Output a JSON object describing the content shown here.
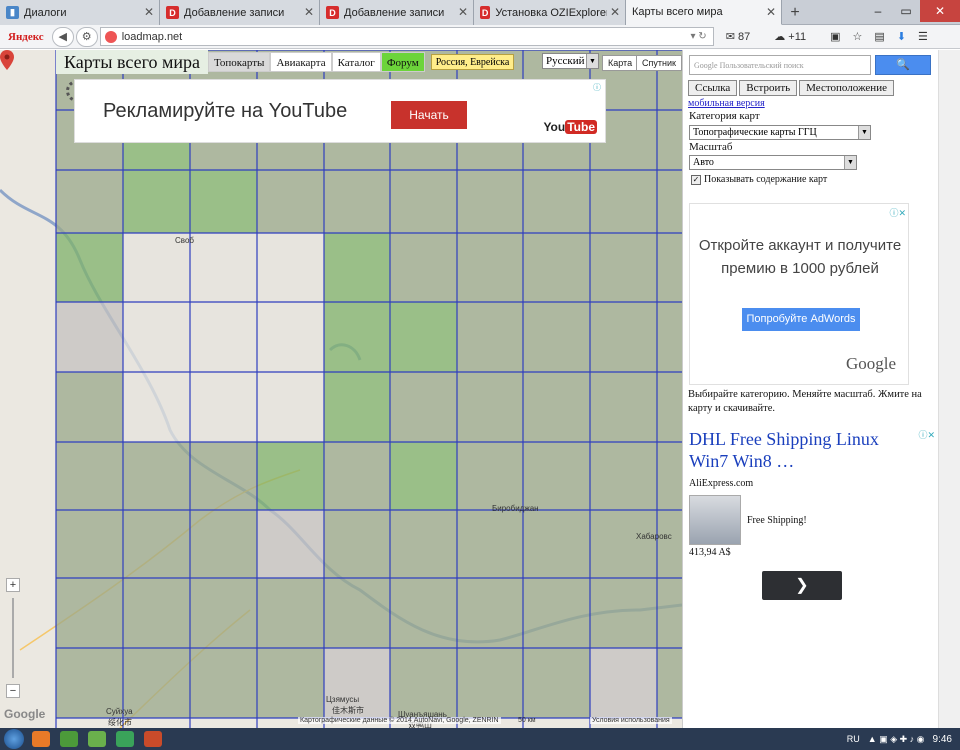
{
  "browser": {
    "tabs": [
      {
        "label": "Диалоги",
        "icon": "dialogs-favicon"
      },
      {
        "label": "Добавление записи",
        "icon": "drive2-favicon"
      },
      {
        "label": "Добавление записи",
        "icon": "drive2-favicon"
      },
      {
        "label": "Установка OZIExplorer от ...",
        "icon": "drive2-favicon"
      },
      {
        "label": "Карты всего мира",
        "icon": "loadmap-favicon"
      }
    ],
    "brand": "Яндекс",
    "url": "loadmap.net",
    "mail_count": "87",
    "weather": "+11",
    "accent": "#2b7de0"
  },
  "map": {
    "site_title": "Карты всего мира",
    "tabs": [
      "Топокарты",
      "Авиакарта",
      "Каталог",
      "Форум"
    ],
    "region": "Россия, Еврейска",
    "language": "Русский",
    "map_types": [
      "Карта",
      "Спутник"
    ],
    "youtube_ad": {
      "text": "Рекламируйте на YouTube",
      "button": "Начать",
      "logo_a": "You",
      "logo_b": "Tube"
    },
    "labels": {
      "svob": "Своб",
      "birobidzhan": "Биробиджан",
      "khabarovsk": "Хабаровс",
      "jiamusi": "Цзямусы",
      "jiamusi_cn": "佳木斯市",
      "shuangyashan": "Шуанъяшань",
      "shuangyashan_cn": "双鸭山",
      "suihua": "Суйхуа",
      "suihua_cn": "绥化市"
    },
    "attribution": "Картографические данные © 2014 AutoNavi, Google, ZENRIN",
    "scale": "50 км",
    "terms": "Условия использования",
    "google_watermark": "Google",
    "zoom_in": "+",
    "zoom_out": "−"
  },
  "sidebar": {
    "search_placeholder": "Пользовательский поиск",
    "search_brand": "Google",
    "search_button": "🔍",
    "buttons": [
      "Ссылка",
      "Встроить",
      "Местоположение"
    ],
    "mobile_link": "мобильная версия",
    "category_label": "Категория карт",
    "category_value": "Топографические карты ГГЦ",
    "scale_label": "Масштаб",
    "scale_value": "Авто",
    "show_contents": "Показывать содержание карт",
    "adwords": {
      "text": "Откройте аккаунт и получите премию в 1000 рублей",
      "button": "Попробуйте AdWords",
      "logo": "Google"
    },
    "hint": "Выбирайте категорию. Меняйте масштаб. Жмите на карту и скачивайте.",
    "text_ad": {
      "headline": "DHL Free Shipping Linux Win7 Win8 …",
      "site": "AliExpress.com",
      "shipping": "Free Shipping!",
      "price": "413,94 A$"
    }
  },
  "taskbar": {
    "lang": "RU",
    "time": "9:46"
  }
}
